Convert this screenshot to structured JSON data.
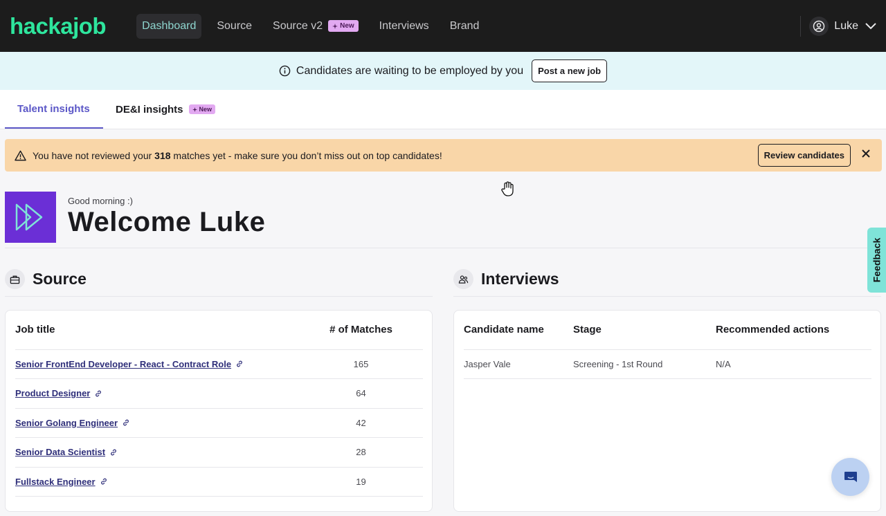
{
  "nav": {
    "logo": "hackajob",
    "items": [
      {
        "label": "Dashboard",
        "active": true
      },
      {
        "label": "Source"
      },
      {
        "label": "Source v2",
        "badge": "New"
      },
      {
        "label": "Interviews"
      },
      {
        "label": "Brand"
      }
    ],
    "user": "Luke"
  },
  "info_banner": {
    "text": "Candidates are waiting to be employed by you",
    "button": "Post a new job"
  },
  "tabs": [
    {
      "label": "Talent insights",
      "active": true
    },
    {
      "label": "DE&I insights",
      "badge": "New"
    }
  ],
  "warning": {
    "text_before": "You have not reviewed your ",
    "count": "318",
    "text_after": " matches yet - make sure you don’t miss out on top candidates!",
    "button": "Review candidates"
  },
  "welcome": {
    "greeting": "Good morning :)",
    "title": "Welcome Luke"
  },
  "source": {
    "title": "Source",
    "columns": [
      "Job title",
      "# of Matches"
    ],
    "rows": [
      {
        "title": "Senior FrontEnd Developer - React - Contract Role",
        "matches": "165"
      },
      {
        "title": "Product Designer",
        "matches": "64"
      },
      {
        "title": "Senior Golang Engineer",
        "matches": "42"
      },
      {
        "title": "Senior Data Scientist",
        "matches": "28"
      },
      {
        "title": "Fullstack Engineer",
        "matches": "19"
      }
    ]
  },
  "interviews": {
    "title": "Interviews",
    "columns": [
      "Candidate name",
      "Stage",
      "Recommended actions"
    ],
    "rows": [
      {
        "name": "Jasper Vale",
        "stage": "Screening - 1st Round",
        "action": "N/A"
      }
    ]
  },
  "feedback": "Feedback",
  "colors": {
    "accent": "#5b57c7",
    "logo": "#2ee59d",
    "warning_bg": "#f9d6a8",
    "info_bg": "#e3f6f9",
    "badge": "#e2a9f1"
  }
}
